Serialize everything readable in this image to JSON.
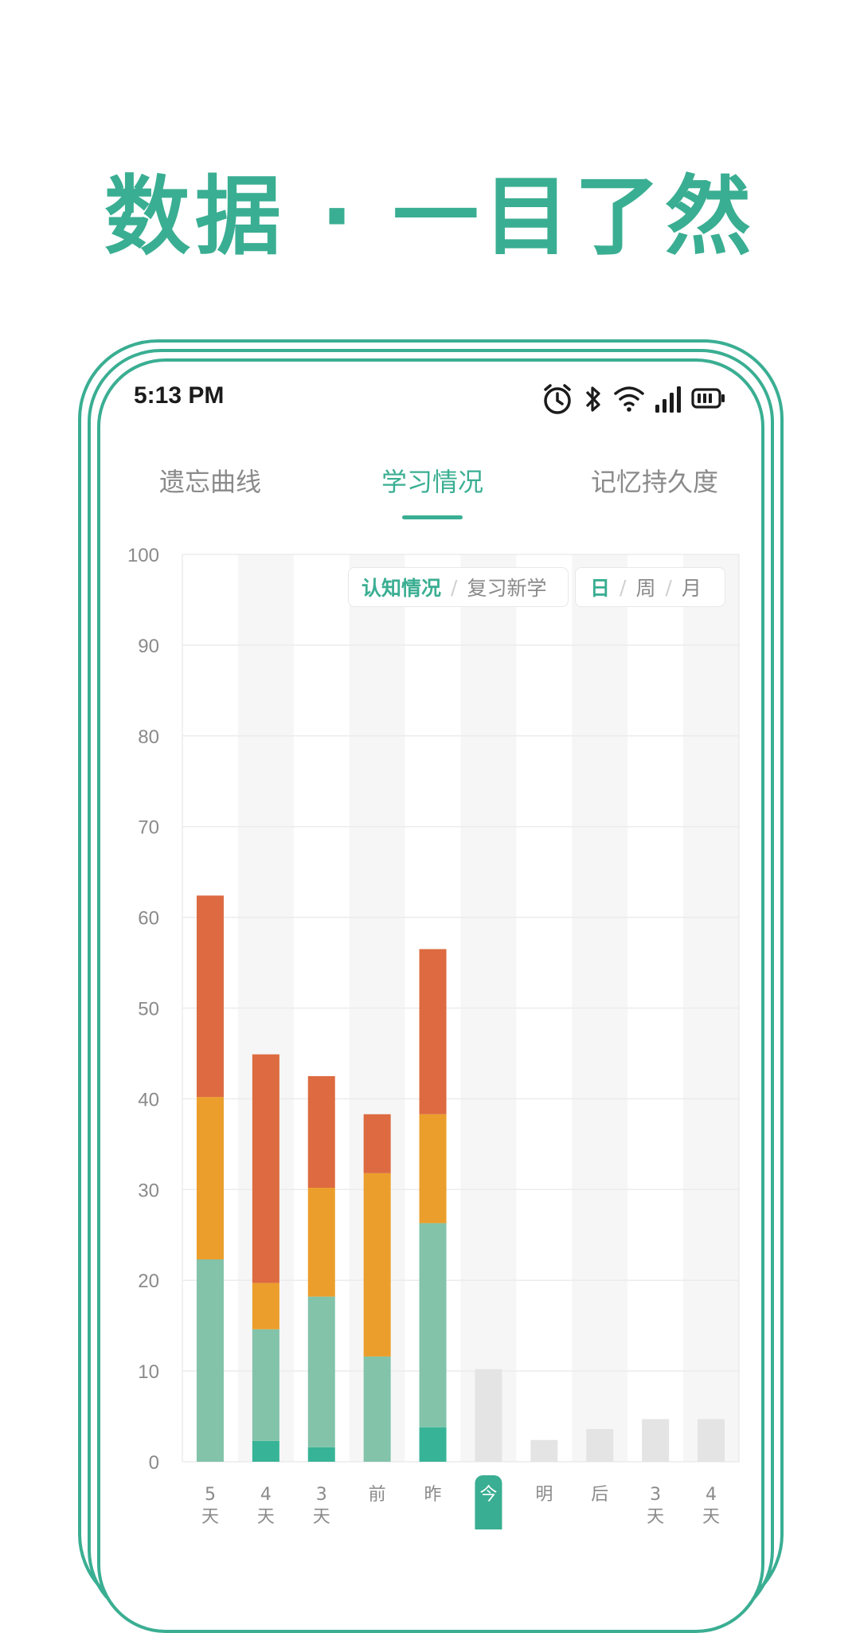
{
  "headline": "数据 · 一目了然",
  "status_bar": {
    "time": "5:13 PM"
  },
  "tabs": [
    {
      "label": "遗忘曲线",
      "active": false
    },
    {
      "label": "学习情况",
      "active": true
    },
    {
      "label": "记忆持久度",
      "active": false
    }
  ],
  "toggles": {
    "mode": {
      "options": [
        "认知情况",
        "复习新学"
      ],
      "selected": "认知情况"
    },
    "period": {
      "options": [
        "日",
        "周",
        "月"
      ],
      "selected": "日"
    }
  },
  "colors": {
    "accent": "#3aae92",
    "dark_green": "#37b497",
    "light_green": "#82c3aa",
    "orange": "#eb9e2b",
    "red_orange": "#dd6a40",
    "future_gray": "#e4e4e4"
  },
  "chart_data": {
    "type": "bar",
    "stacked": true,
    "ylim": [
      0,
      100
    ],
    "yticks": [
      0,
      10,
      20,
      30,
      40,
      50,
      60,
      70,
      80,
      90,
      100
    ],
    "categories": [
      "5天前",
      "4天前",
      "3天前",
      "前天",
      "昨天",
      "今天",
      "明天",
      "后天",
      "3天后",
      "4天后"
    ],
    "highlight_category": "今天",
    "series": [
      {
        "color": "#37b497",
        "values": [
          0,
          2.3,
          1.6,
          0,
          3.8,
          0,
          0,
          0,
          0,
          0
        ]
      },
      {
        "color": "#82c3aa",
        "values": [
          22.3,
          12.3,
          16.6,
          11.6,
          22.5,
          0,
          0,
          0,
          0,
          0
        ]
      },
      {
        "color": "#eb9e2b",
        "values": [
          17.9,
          5.1,
          12.0,
          20.2,
          12.0,
          0,
          0,
          0,
          0,
          0
        ]
      },
      {
        "color": "#dd6a40",
        "values": [
          22.2,
          25.2,
          12.3,
          6.5,
          18.2,
          0,
          0,
          0,
          0,
          0
        ]
      },
      {
        "color": "#e4e4e4",
        "values": [
          0,
          0,
          0,
          0,
          0,
          10.2,
          2.4,
          3.6,
          4.7,
          4.7
        ]
      }
    ],
    "grid": true,
    "legend": "none"
  }
}
